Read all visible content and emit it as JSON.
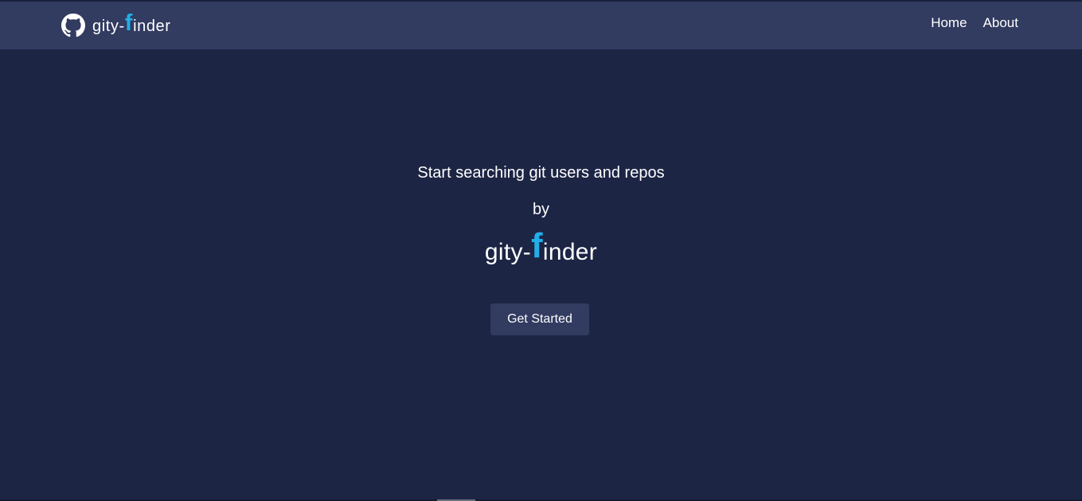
{
  "colors": {
    "background": "#1d2545",
    "navbar": "#323b60",
    "accent": "#23aee8",
    "text": "#ffffff"
  },
  "navbar": {
    "logo_icon": "github-octocat-icon",
    "brand": {
      "prefix": "gity-",
      "accent_letter": "f",
      "suffix": "inder"
    },
    "links": [
      {
        "label": "Home"
      },
      {
        "label": "About"
      }
    ]
  },
  "hero": {
    "subtitle": "Start searching git users and repos",
    "by": "by",
    "brand": {
      "prefix": "gity-",
      "accent_letter": "f",
      "suffix": "inder"
    },
    "cta_label": "Get Started"
  }
}
